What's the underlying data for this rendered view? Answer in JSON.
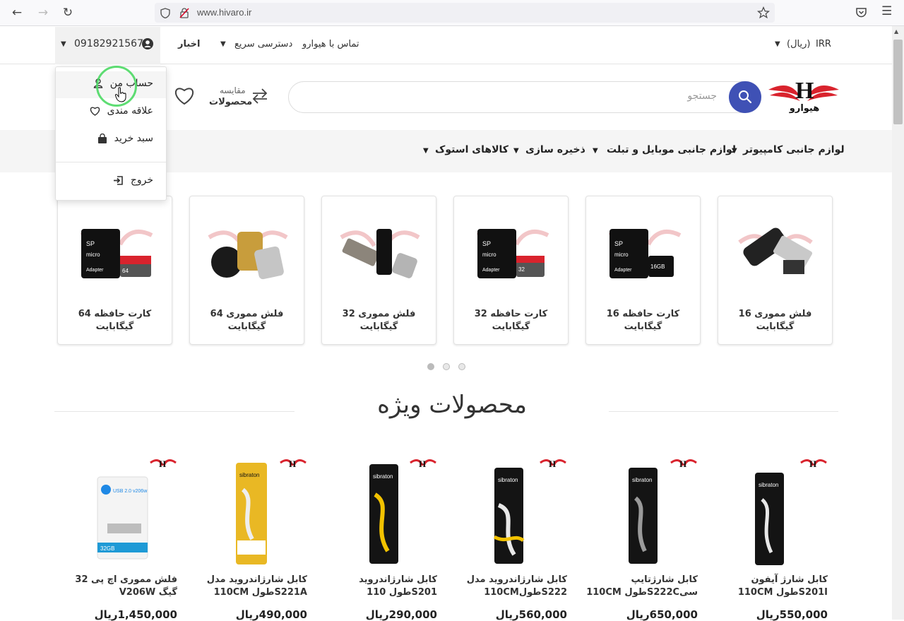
{
  "browser": {
    "url": "www.hivaro.ir"
  },
  "topbar": {
    "currency": "IRR",
    "currency_label": "(ریال)",
    "contact": "تماس با هیوارو",
    "quick_access": "دسترسی سریع",
    "news": "اخبار",
    "phone": "09182921567"
  },
  "header": {
    "logo_text": "هیوارو",
    "search_placeholder": "جستجو",
    "compare_line1": "مقایسه",
    "compare_line2": "محصولات"
  },
  "categories": [
    {
      "label": "لوازم جانبی کامپیوتر"
    },
    {
      "label": "لوازم جانبی موبایل و تبلت"
    },
    {
      "label": "ذخیره سازی"
    },
    {
      "label": "کالاهای استوک"
    }
  ],
  "carousel": [
    {
      "title": "فلش مموری 16 گیگابایت",
      "image": "usb-flash-pair"
    },
    {
      "title": "کارت حافظه 16 گیگابایت",
      "image": "micro-sd-card"
    },
    {
      "title": "کارت حافظه 32 گیگابایت",
      "image": "micro-sd-card"
    },
    {
      "title": "فلش مموری 32 گیگابایت",
      "image": "usb-flash-trio"
    },
    {
      "title": "فلش مموری 64 گیگابایت",
      "image": "usb-flash-trio-gold"
    },
    {
      "title": "کارت حافظه 64 گیگابایت",
      "image": "micro-sd-card"
    }
  ],
  "featured": {
    "title": "محصولات ویژه",
    "products": [
      {
        "name": "کابل شارژ آیفون S201Iطول 110CM",
        "price": "550,000ریال"
      },
      {
        "name": "کابل شارژتایپ سیS222Cطول 110CM",
        "price": "650,000ریال"
      },
      {
        "name": "کابل شارژاندروید مدل S222طول110CM",
        "price": "560,000ریال"
      },
      {
        "name": "کابل شارژاندروید S201طول 110",
        "price": "290,000ریال"
      },
      {
        "name": "کابل شارژاندروید مدل S221Aطول 110CM",
        "price": "490,000ریال"
      },
      {
        "name": "فلش مموری اچ پی 32 گیگ V206W",
        "price": "1,450,000ریال"
      }
    ]
  },
  "account_menu": {
    "items": [
      {
        "label": "حساب من",
        "icon": "user-icon"
      },
      {
        "label": "علاقه مندی",
        "icon": "heart-icon"
      },
      {
        "label": "سبد خرید",
        "icon": "bag-icon"
      },
      {
        "label": "خروج",
        "icon": "logout-icon"
      }
    ]
  },
  "colors": {
    "accent": "#3f51b5",
    "logo_red": "#d9232d",
    "category_bg": "#f5f5f5"
  }
}
